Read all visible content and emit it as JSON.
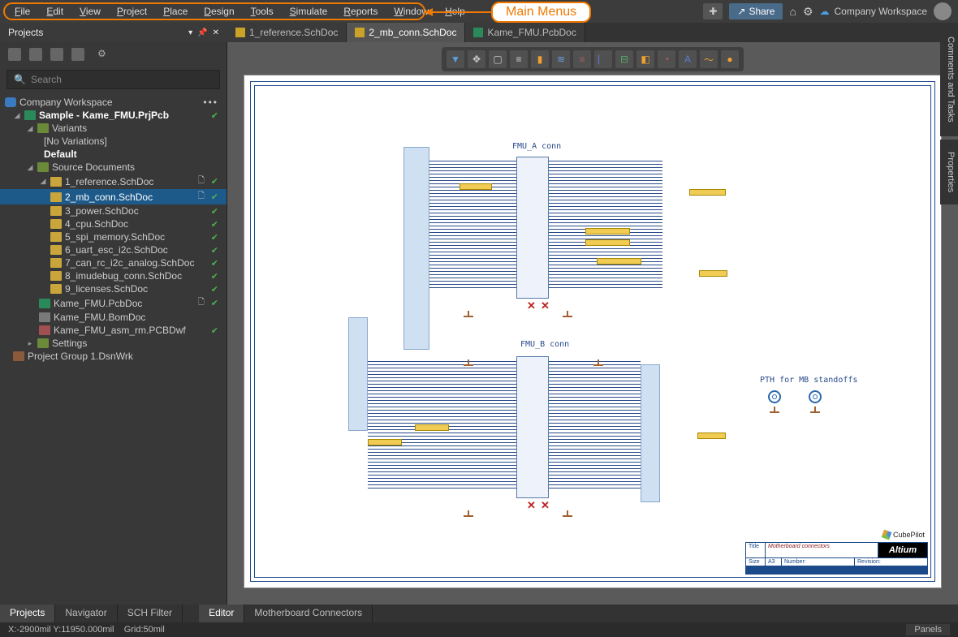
{
  "menubar": {
    "items": [
      "File",
      "Edit",
      "View",
      "Project",
      "Place",
      "Design",
      "Tools",
      "Simulate",
      "Reports",
      "Window",
      "Help"
    ],
    "share_label": "Share",
    "workspace_label": "Company Workspace"
  },
  "callout": {
    "label": "Main Menus"
  },
  "projects_panel": {
    "title": "Projects",
    "search_placeholder": "Search"
  },
  "tree": {
    "workspace": "Company Workspace",
    "project": "Sample - Kame_FMU.PrjPcb",
    "variants_label": "Variants",
    "no_variations": "[No Variations]",
    "default_label": "Default",
    "source_docs_label": "Source Documents",
    "docs": [
      "1_reference.SchDoc",
      "2_mb_conn.SchDoc",
      "3_power.SchDoc",
      "4_cpu.SchDoc",
      "5_spi_memory.SchDoc",
      "6_uart_esc_i2c.SchDoc",
      "7_can_rc_i2c_analog.SchDoc",
      "8_imudebug_conn.SchDoc",
      "9_licenses.SchDoc"
    ],
    "pcbdoc": "Kame_FMU.PcbDoc",
    "bomdoc": "Kame_FMU.BomDoc",
    "pcbdwf": "Kame_FMU_asm_rm.PCBDwf",
    "settings": "Settings",
    "project_group": "Project Group 1.DsnWrk"
  },
  "doc_tabs": [
    {
      "label": "1_reference.SchDoc",
      "active": false,
      "kind": "sch"
    },
    {
      "label": "2_mb_conn.SchDoc",
      "active": true,
      "kind": "sch"
    },
    {
      "label": "Kame_FMU.PcbDoc",
      "active": false,
      "kind": "pcb"
    }
  ],
  "schematic": {
    "conn_a_title": "FMU_A conn",
    "conn_b_title": "FMU_B conn",
    "standoff_title": "PTH for MB standoffs",
    "cubepilot": "CubePilot"
  },
  "title_block": {
    "title_label": "Title",
    "title_value": "Motherboard connectors",
    "size_label": "Size",
    "size_value": "A3",
    "number_label": "Number:",
    "revision_label": "Revision:",
    "altium": "Altium"
  },
  "bottom_tabs": {
    "left": [
      "Projects",
      "Navigator",
      "SCH Filter"
    ],
    "right": [
      "Editor",
      "Motherboard Connectors"
    ]
  },
  "status": {
    "coords": "X:-2900mil Y:11950.000mil",
    "grid": "Grid:50mil",
    "panels": "Panels"
  },
  "side_rails": [
    "Comments and Tasks",
    "Properties"
  ]
}
